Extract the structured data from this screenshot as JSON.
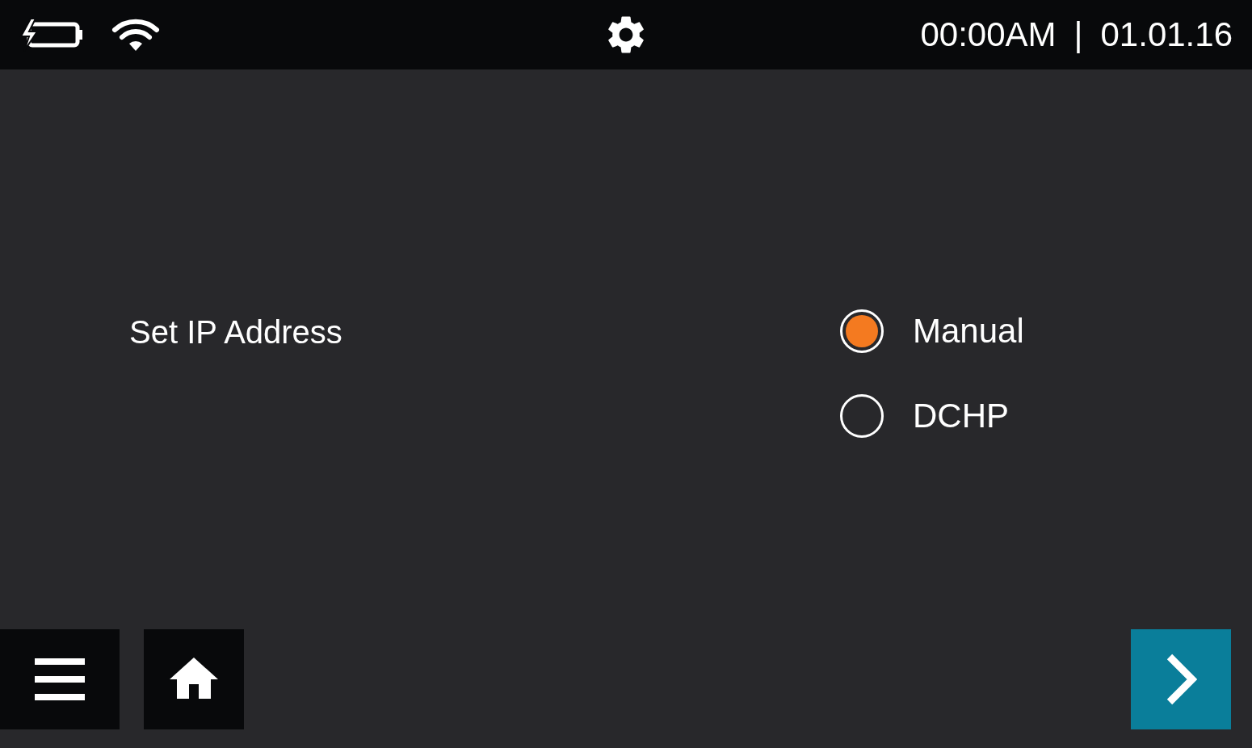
{
  "status_bar": {
    "time": "00:00AM",
    "separator": "|",
    "date": "01.01.16"
  },
  "setting": {
    "label": "Set IP Address",
    "options": [
      {
        "label": "Manual",
        "selected": true
      },
      {
        "label": "DCHP",
        "selected": false
      }
    ]
  }
}
